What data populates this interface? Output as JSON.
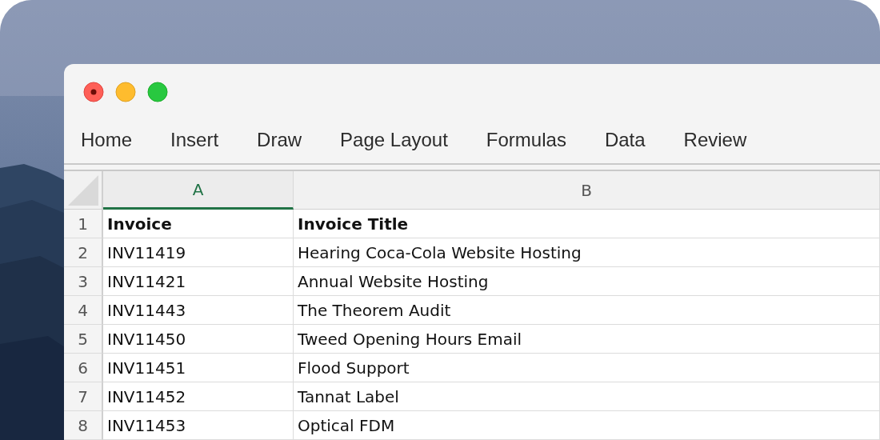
{
  "ribbon_tabs": [
    {
      "label": "Home"
    },
    {
      "label": "Insert"
    },
    {
      "label": "Draw"
    },
    {
      "label": "Page Layout"
    },
    {
      "label": "Formulas"
    },
    {
      "label": "Data"
    },
    {
      "label": "Review"
    }
  ],
  "sheet": {
    "columns": [
      {
        "label": "A",
        "selected": true
      },
      {
        "label": "B",
        "selected": false
      }
    ],
    "rows": [
      {
        "number": "1",
        "kind": "header",
        "cells": [
          "Invoice",
          "Invoice Title"
        ]
      },
      {
        "number": "2",
        "kind": "data",
        "cells": [
          "INV11419",
          "Hearing Coca-Cola Website Hosting"
        ]
      },
      {
        "number": "3",
        "kind": "data",
        "cells": [
          "INV11421",
          "Annual Website Hosting"
        ]
      },
      {
        "number": "4",
        "kind": "data",
        "cells": [
          "INV11443",
          "The Theorem Audit"
        ]
      },
      {
        "number": "5",
        "kind": "data",
        "cells": [
          "INV11450",
          "Tweed Opening Hours Email"
        ]
      },
      {
        "number": "6",
        "kind": "data",
        "cells": [
          "INV11451",
          "Flood Support"
        ]
      },
      {
        "number": "7",
        "kind": "data",
        "cells": [
          "INV11452",
          "Tannat Label"
        ]
      },
      {
        "number": "8",
        "kind": "data",
        "cells": [
          "INV11453",
          "Optical FDM"
        ]
      }
    ]
  }
}
